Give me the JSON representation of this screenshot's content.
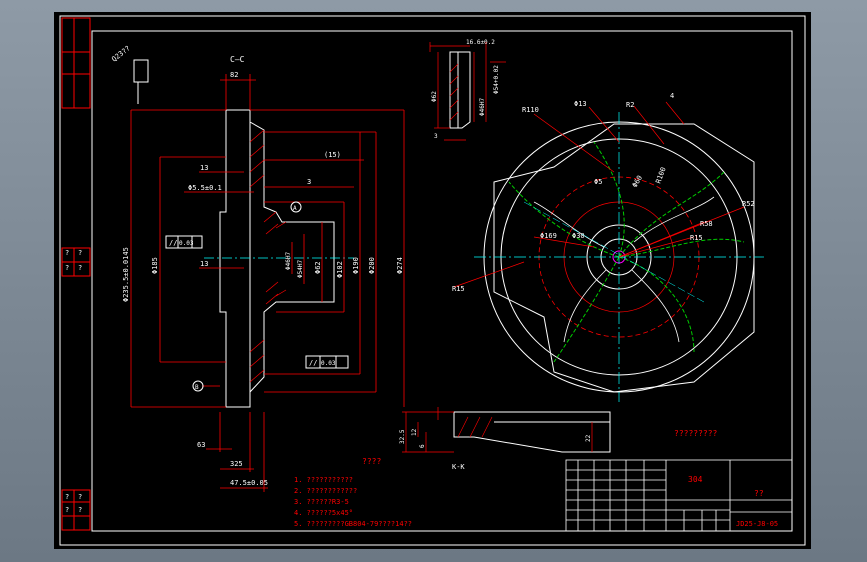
{
  "section_label": "C—C",
  "view_kk_label": "K-K",
  "roughness_note": "????",
  "title_material": "304",
  "title_name": "??",
  "drawing_number": "JD25-J8-05",
  "standard_text": "Q23??",
  "tech_req_note": "?????????",
  "notes": [
    "1. ???????????",
    "2. ????????????",
    "3. ??????R3-5",
    "4. ??????5x45°",
    "5. ?????????GB804-79????14??"
  ],
  "side_box_text": [
    "?",
    "?",
    "?",
    "?",
    "?",
    "?",
    "?",
    "?"
  ],
  "dims_section": {
    "top_width": "82",
    "od_label": "Φ235.5±0.0145",
    "d185": "Φ185",
    "d13a": "13",
    "d55": "Φ5.5±0.1",
    "d15": "(15)",
    "d3": "3",
    "d13b": "13",
    "d46": "Φ46H7",
    "d54": "Φ54H7",
    "d62": "Φ62",
    "d102": "Φ102",
    "d190": "Φ190",
    "d200": "Φ200",
    "d224": "Φ274",
    "d63": "63",
    "d325": "325",
    "d475": "47.5±0.05",
    "tol1": "0.03",
    "tol2": "0.03",
    "datum_a": "A",
    "datum_b": "B",
    "tol_sym1": "//",
    "tol_sym2": "//"
  },
  "dims_keyway": {
    "top": "16.6±0.2",
    "d62": "Φ62",
    "d3": "3",
    "a": "Φ46H7",
    "b": "Φ54+0.02"
  },
  "dims_impeller": {
    "r110": "R110",
    "d13": "Φ13",
    "r2": "R2",
    "d4": "4",
    "d60": "Φ60",
    "r100": "R100",
    "r58": "R58",
    "r52": "R52",
    "d5": "Φ5",
    "d169": "Φ169",
    "d30": "Φ30",
    "r15": "R15",
    "r15b": "R15"
  },
  "dims_kk": {
    "a": "32.5",
    "b": "12",
    "c": "6",
    "d": "22"
  }
}
